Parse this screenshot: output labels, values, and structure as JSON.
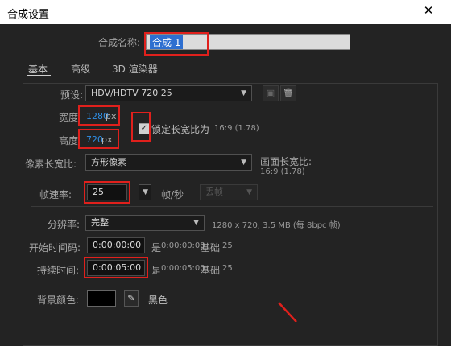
{
  "window": {
    "title": "合成设置"
  },
  "name_row": {
    "label": "合成名称:",
    "value": "合成 1"
  },
  "tabs": [
    {
      "label": "基本"
    },
    {
      "label": "高级"
    },
    {
      "label": "3D 渲染器"
    }
  ],
  "preset": {
    "label": "预设:",
    "value": "HDV/HDTV 720 25"
  },
  "width": {
    "label": "宽度",
    "value": "1280",
    "unit": "px"
  },
  "height": {
    "label": "高度",
    "value": "720",
    "unit": "px"
  },
  "lock_aspect": {
    "label": "锁定长宽比为",
    "ratio": "16:9 (1.78)",
    "checked": true
  },
  "pixel_aspect": {
    "label": "像素长宽比:",
    "value": "方形像素"
  },
  "frame_aspect": {
    "label": "画面长宽比:",
    "value": "16:9 (1.78)"
  },
  "frame_rate": {
    "label": "帧速率:",
    "value": "25",
    "unit": "帧/秒",
    "drop_label": "丢帧"
  },
  "resolution": {
    "label": "分辨率:",
    "value": "完整",
    "info": "1280 x 720, 3.5 MB (每 8bpc 帧)"
  },
  "start_tc": {
    "label": "开始时间码:",
    "value": "0:00:00:00",
    "is_label": "是",
    "info_time": "0:00:00:00",
    "base_label": "基础",
    "base": "25"
  },
  "duration": {
    "label": "持续时间:",
    "value": "0:00:05:00",
    "is_label": "是",
    "info_time": "0:00:05:00",
    "base_label": "基础",
    "base": "25"
  },
  "bg_color": {
    "label": "背景颜色:",
    "color_name": "黑色",
    "swatch": "#000000"
  },
  "colors": {
    "highlight_red": "#e0201c",
    "accent_blue": "#2f8fe6"
  }
}
